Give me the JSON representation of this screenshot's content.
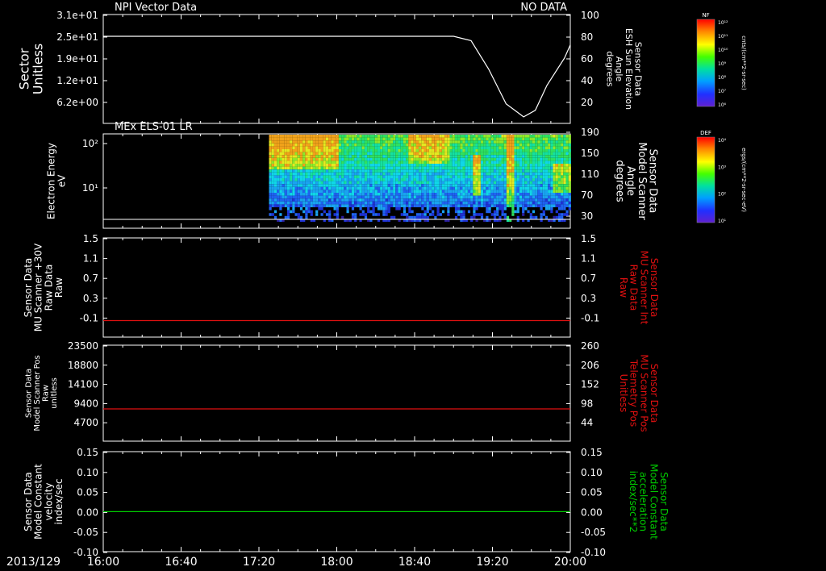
{
  "colors": {
    "background": "#000000",
    "axis": "#ffffff",
    "red_trace": "#e01010",
    "green_trace": "#00cc00"
  },
  "chart_data": [
    {
      "type": "line",
      "title": "NPI Vector Data",
      "status": "NO DATA",
      "ylabel": [
        "Sector",
        "Unitless"
      ],
      "ylabel_right": [
        "Sensor Data",
        "ESH Sun Elevation",
        "Angle",
        "degrees"
      ],
      "left_ticks": [
        "3.1e+01",
        "2.5e+01",
        "1.9e+01",
        "1.2e+01",
        "6.2e+00"
      ],
      "right_ticks": [
        "100",
        "80",
        "60",
        "40",
        "20"
      ],
      "right_ylim": [
        0,
        100
      ],
      "series": [
        {
          "color": "#ffffff",
          "axis": "right",
          "x_hours": [
            16.0,
            19.0,
            19.15,
            19.3,
            19.45,
            19.6,
            19.7,
            19.8,
            19.95,
            20.0
          ],
          "values": [
            80,
            80,
            76,
            50,
            18,
            6,
            12,
            35,
            60,
            72
          ]
        }
      ]
    },
    {
      "type": "heatmap",
      "title": "MEx ELS-01 LR",
      "ylabel": [
        "Electron Energy",
        "eV"
      ],
      "ylabel_right": [
        "Sensor Data",
        "Model Scanner",
        "Angle",
        "degrees"
      ],
      "left_ticks": [
        "10²",
        "10¹"
      ],
      "right_ticks": [
        "190",
        "150",
        "110",
        "70",
        "30"
      ],
      "data_start_hour": 17.42,
      "colorbar": {
        "label": "DEF",
        "units": "ergs/(cm**2-sr-sec-eV)",
        "ticks": [
          "10⁴",
          "10³",
          "10²",
          "10¹"
        ]
      }
    },
    {
      "type": "line",
      "ylabel": [
        "Sensor Data",
        "MU Scanner +30V",
        "Raw Data",
        "Raw"
      ],
      "ylabel_right": [
        "Sensor Data",
        "MU Scanner Int",
        "Raw Data",
        "Raw"
      ],
      "left_ticks": [
        "1.5",
        "1.1",
        "0.7",
        "0.3",
        "-0.1"
      ],
      "right_ticks": [
        "1.5",
        "1.1",
        "0.7",
        "0.3",
        "-0.1"
      ],
      "ylim": [
        -0.3,
        1.5
      ],
      "series": [
        {
          "color": "#e01010",
          "values": [
            0.0
          ]
        }
      ]
    },
    {
      "type": "line",
      "ylabel": [
        "Sensor Data",
        "Model Scanner Pos",
        "Raw",
        "unitless"
      ],
      "ylabel_right": [
        "Sensor Data",
        "MU Scanner Pos",
        "Telemetry Pos",
        "Unitless"
      ],
      "left_ticks": [
        "23500",
        "18800",
        "14100",
        "9400",
        "4700"
      ],
      "right_ticks": [
        "260",
        "206",
        "152",
        "98",
        "44"
      ],
      "ylim": [
        0,
        23500
      ],
      "series": [
        {
          "color": "#e01010",
          "values": [
            7900
          ]
        }
      ]
    },
    {
      "type": "line",
      "ylabel": [
        "Sensor Data",
        "Model Constant",
        "velocity",
        "index/sec"
      ],
      "ylabel_right": [
        "Sensor Data",
        "Model Constant",
        "acceleration",
        "index/sec**2"
      ],
      "left_ticks": [
        "0.15",
        "0.10",
        "0.05",
        "0.00",
        "-0.05",
        "-0.10"
      ],
      "right_ticks": [
        "0.15",
        "0.10",
        "0.05",
        "0.00",
        "-0.05",
        "-0.10"
      ],
      "ylim": [
        -0.1,
        0.15
      ],
      "series": [
        {
          "color": "#00cc00",
          "values": [
            0.0
          ]
        }
      ]
    }
  ],
  "xaxis": {
    "date": "2013/129",
    "tick_labels": [
      "16:00",
      "16:40",
      "17:20",
      "18:00",
      "18:40",
      "19:20",
      "20:00"
    ],
    "range_hours": [
      16.0,
      20.0
    ]
  },
  "colorbar_nf": {
    "label": "NF",
    "units": "cnts/(cm**2-sr-sec)",
    "ticks": [
      "10¹²",
      "10¹¹",
      "10¹⁰",
      "10⁹",
      "10⁸",
      "10⁷",
      "10⁶"
    ]
  }
}
